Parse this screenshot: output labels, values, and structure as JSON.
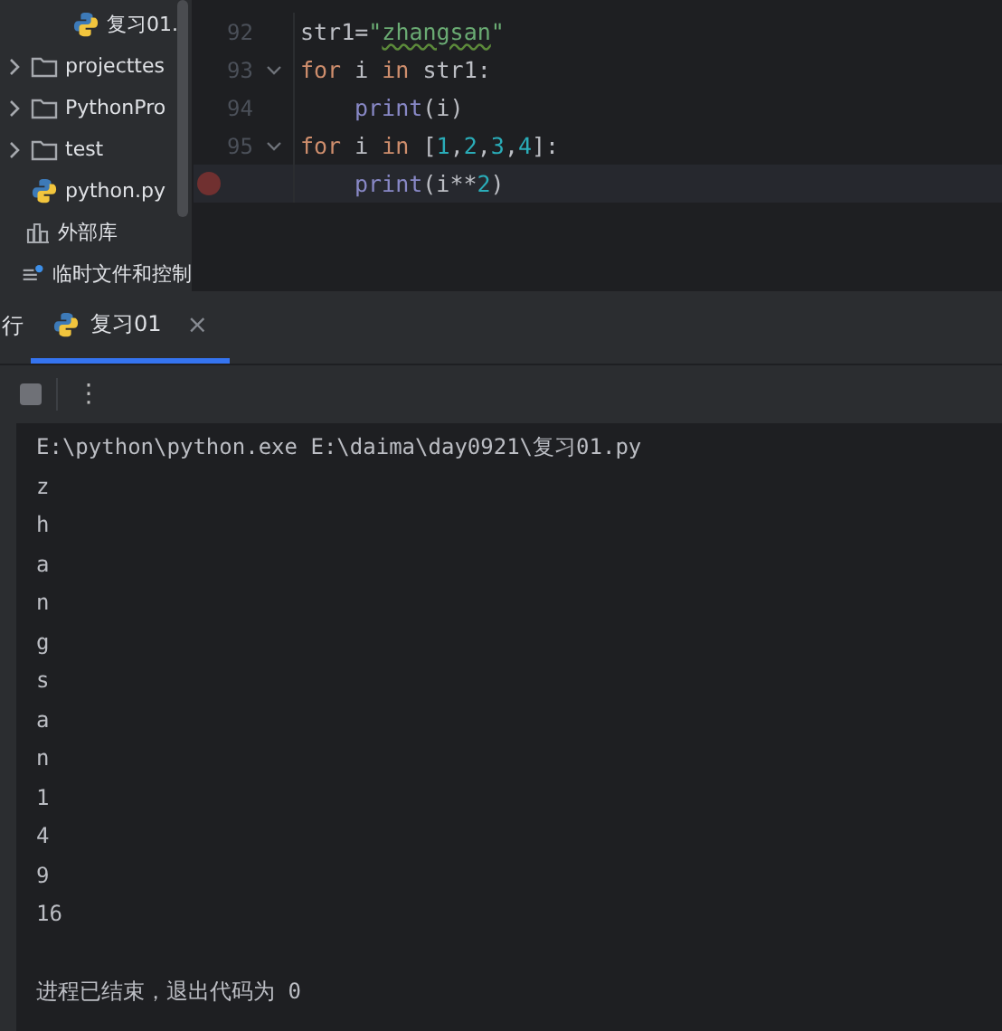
{
  "project_tree": {
    "open_folder_children": [
      {
        "label": "复习01.",
        "kind": "python",
        "expandable": false
      }
    ],
    "items": [
      {
        "label": "projecttes",
        "kind": "folder",
        "expandable": true
      },
      {
        "label": "PythonPro",
        "kind": "folder",
        "expandable": true
      },
      {
        "label": "test",
        "kind": "folder",
        "expandable": true
      },
      {
        "label": "python.py",
        "kind": "python",
        "expandable": false
      },
      {
        "label": "外部库",
        "kind": "library",
        "expandable": false
      },
      {
        "label": "临时文件和控制",
        "kind": "scratch",
        "expandable": false
      }
    ]
  },
  "editor": {
    "lines": [
      {
        "number": "92",
        "indented": false,
        "fold": false,
        "breakpoint": false,
        "current": false,
        "tokens": [
          {
            "text": "str1=",
            "kind": "plain"
          },
          {
            "text": "\"",
            "kind": "string"
          },
          {
            "text": "zhangsan",
            "kind": "string_typo"
          },
          {
            "text": "\"",
            "kind": "string"
          }
        ]
      },
      {
        "number": "93",
        "indented": false,
        "fold": true,
        "breakpoint": false,
        "current": false,
        "tokens": [
          {
            "text": "for",
            "kind": "keyword"
          },
          {
            "text": " i ",
            "kind": "plain"
          },
          {
            "text": "in",
            "kind": "keyword"
          },
          {
            "text": " str1:",
            "kind": "plain"
          }
        ]
      },
      {
        "number": "94",
        "indented": true,
        "fold": false,
        "breakpoint": false,
        "current": false,
        "tokens": [
          {
            "text": "print",
            "kind": "builtin"
          },
          {
            "text": "(i)",
            "kind": "plain"
          }
        ]
      },
      {
        "number": "95",
        "indented": false,
        "fold": true,
        "breakpoint": false,
        "current": false,
        "tokens": [
          {
            "text": "for",
            "kind": "keyword"
          },
          {
            "text": " i ",
            "kind": "plain"
          },
          {
            "text": "in",
            "kind": "keyword"
          },
          {
            "text": " [",
            "kind": "plain"
          },
          {
            "text": "1",
            "kind": "number"
          },
          {
            "text": ",",
            "kind": "plain"
          },
          {
            "text": "2",
            "kind": "number"
          },
          {
            "text": ",",
            "kind": "plain"
          },
          {
            "text": "3",
            "kind": "number"
          },
          {
            "text": ",",
            "kind": "plain"
          },
          {
            "text": "4",
            "kind": "number"
          },
          {
            "text": "]:",
            "kind": "plain"
          }
        ]
      },
      {
        "indented": true,
        "fold": false,
        "breakpoint": true,
        "current": true,
        "tokens": [
          {
            "text": "print",
            "kind": "builtin"
          },
          {
            "text": "(i**",
            "kind": "plain"
          },
          {
            "text": "2",
            "kind": "number"
          },
          {
            "text": ")",
            "kind": "plain"
          }
        ]
      }
    ]
  },
  "run_panel": {
    "title_fragment": "行",
    "tabs": [
      {
        "label": "复习01",
        "selected": true,
        "close": "×"
      }
    ],
    "menu": "⋮"
  },
  "console": {
    "lines": [
      {
        "text": "E:\\python\\python.exe E:\\daima\\day0921\\复习01.py",
        "kind": "output"
      },
      {
        "text": "z",
        "kind": "output"
      },
      {
        "text": "h",
        "kind": "output"
      },
      {
        "text": "a",
        "kind": "output"
      },
      {
        "text": "n",
        "kind": "output"
      },
      {
        "text": "g",
        "kind": "output"
      },
      {
        "text": "s",
        "kind": "output"
      },
      {
        "text": "a",
        "kind": "output"
      },
      {
        "text": "n",
        "kind": "output"
      },
      {
        "text": "1",
        "kind": "output"
      },
      {
        "text": "4",
        "kind": "output"
      },
      {
        "text": "9",
        "kind": "output"
      },
      {
        "text": "16",
        "kind": "output"
      },
      {
        "text": "进程已结束，退出代码为 0",
        "kind": "exit"
      }
    ]
  }
}
